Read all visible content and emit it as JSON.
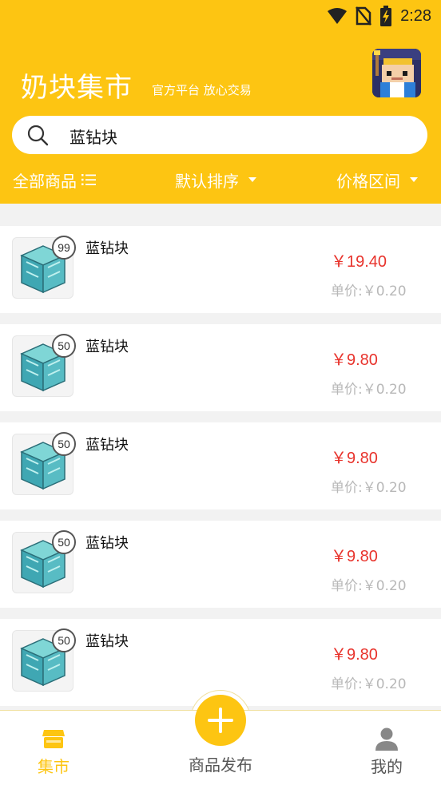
{
  "status_bar": {
    "time": "2:28",
    "icons": [
      "wifi-icon",
      "no-sim-icon",
      "battery-charging-icon"
    ]
  },
  "header": {
    "title": "奶块集市",
    "subtitle": "官方平台 放心交易",
    "avatar": "game-avatar"
  },
  "search": {
    "value": "蓝钻块",
    "icon": "search-icon"
  },
  "filters": {
    "all_label": "全部商品",
    "sort_label": "默认排序",
    "price_label": "价格区间"
  },
  "items": [
    {
      "name": "蓝钻块",
      "qty": "99",
      "price": "￥19.40",
      "unit_price": "单价:￥0.20"
    },
    {
      "name": "蓝钻块",
      "qty": "50",
      "price": "￥9.80",
      "unit_price": "单价:￥0.20"
    },
    {
      "name": "蓝钻块",
      "qty": "50",
      "price": "￥9.80",
      "unit_price": "单价:￥0.20"
    },
    {
      "name": "蓝钻块",
      "qty": "50",
      "price": "￥9.80",
      "unit_price": "单价:￥0.20"
    },
    {
      "name": "蓝钻块",
      "qty": "50",
      "price": "￥9.80",
      "unit_price": "单价:￥0.20"
    }
  ],
  "bottom_nav": {
    "market_label": "集市",
    "publish_label": "商品发布",
    "mine_label": "我的"
  },
  "colors": {
    "brand": "#fdc512",
    "price": "#e8332c",
    "muted": "#b8b8b8"
  }
}
